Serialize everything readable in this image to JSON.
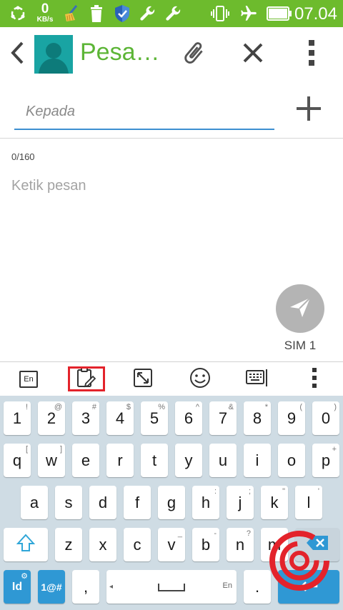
{
  "status_bar": {
    "net_speed_value": "0",
    "net_speed_unit": "KB/s",
    "time": "07.04",
    "icons": [
      "sync-icon",
      "broom-icon",
      "trash-icon",
      "shield-icon",
      "wrench-icon",
      "wrench-icon",
      "vibrate-icon",
      "airplane-icon",
      "battery-icon"
    ]
  },
  "toolbar": {
    "title": "Pesa…",
    "back_icon": "chevron-left-icon",
    "attach_icon": "paperclip-icon",
    "close_icon": "close-icon",
    "menu_icon": "more-vert-icon"
  },
  "compose": {
    "recipient_placeholder": "Kepada",
    "char_counter": "0/160",
    "message_placeholder": "Ketik pesan",
    "sim_label": "SIM 1"
  },
  "keyboard_toolbar": {
    "lang_badge": "En",
    "tools": [
      "language-icon",
      "clipboard-edit-icon",
      "resize-icon",
      "emoji-icon",
      "keyboard-settings-icon",
      "more-vert-icon"
    ]
  },
  "keyboard": {
    "number_row": [
      {
        "main": "1",
        "hint": "!"
      },
      {
        "main": "2",
        "hint": "@"
      },
      {
        "main": "3",
        "hint": "#"
      },
      {
        "main": "4",
        "hint": "$"
      },
      {
        "main": "5",
        "hint": "%"
      },
      {
        "main": "6",
        "hint": "^"
      },
      {
        "main": "7",
        "hint": "&"
      },
      {
        "main": "8",
        "hint": "*"
      },
      {
        "main": "9",
        "hint": "("
      },
      {
        "main": "0",
        "hint": ")"
      }
    ],
    "row1": [
      {
        "main": "q",
        "hint": "["
      },
      {
        "main": "w",
        "hint": "]"
      },
      {
        "main": "e",
        "hint": ""
      },
      {
        "main": "r",
        "hint": ""
      },
      {
        "main": "t",
        "hint": ""
      },
      {
        "main": "y",
        "hint": ""
      },
      {
        "main": "u",
        "hint": ""
      },
      {
        "main": "i",
        "hint": ""
      },
      {
        "main": "o",
        "hint": ""
      },
      {
        "main": "p",
        "hint": "+"
      }
    ],
    "row2": [
      {
        "main": "a",
        "hint": ""
      },
      {
        "main": "s",
        "hint": ""
      },
      {
        "main": "d",
        "hint": ""
      },
      {
        "main": "f",
        "hint": ""
      },
      {
        "main": "g",
        "hint": ""
      },
      {
        "main": "h",
        "hint": ":"
      },
      {
        "main": "j",
        "hint": ";"
      },
      {
        "main": "k",
        "hint": "\""
      },
      {
        "main": "l",
        "hint": "'"
      }
    ],
    "row3": [
      {
        "main": "z",
        "hint": ""
      },
      {
        "main": "x",
        "hint": ""
      },
      {
        "main": "c",
        "hint": ""
      },
      {
        "main": "v",
        "hint": "_"
      },
      {
        "main": "b",
        "hint": "-"
      },
      {
        "main": "n",
        "hint": "?"
      },
      {
        "main": "m",
        "hint": ""
      }
    ],
    "bottom": {
      "id_key": "Id",
      "symbols_key": "1@#",
      "comma_key": ",",
      "space_lang": "En",
      "period_key": "."
    }
  },
  "colors": {
    "status_bar": "#6dbb2d",
    "title_green": "#5cb536",
    "field_underline": "#3d8fd1",
    "send_button": "#b4b4b4",
    "keyboard_bg": "#cfdce4",
    "key_blue": "#2f98d4",
    "highlight_red": "#e3232b"
  }
}
